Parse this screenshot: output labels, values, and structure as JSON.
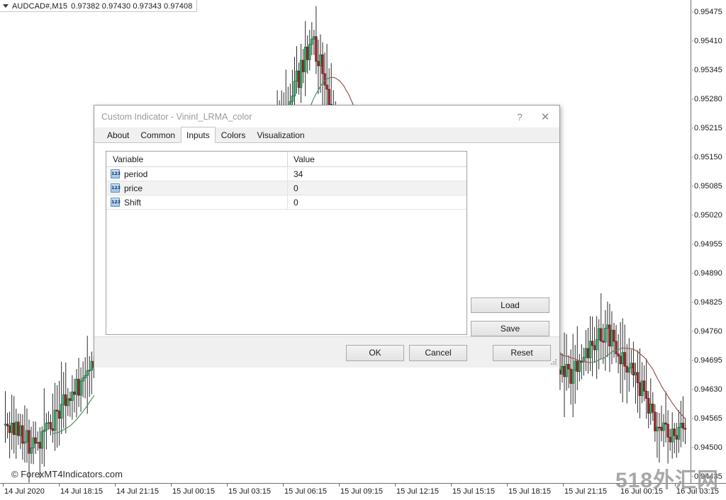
{
  "chart": {
    "symbol_label": "AUDCAD#,M15",
    "ohlc": "0.97382 0.97430 0.97343 0.97408",
    "watermark_left": "© ForexMT4Indicators.com",
    "watermark_right": "518外汇网",
    "price_ticks": [
      "0.95475",
      "0.95410",
      "0.95345",
      "0.95280",
      "0.95215",
      "0.95150",
      "0.95085",
      "0.95020",
      "0.94955",
      "0.94890",
      "0.94825",
      "0.94760",
      "0.94695",
      "0.94630",
      "0.94565",
      "0.94500",
      "0.94435"
    ],
    "time_ticks": [
      "14 Jul 2020",
      "14 Jul 18:15",
      "14 Jul 21:15",
      "15 Jul 00:15",
      "15 Jul 03:15",
      "15 Jul 06:15",
      "15 Jul 09:15",
      "15 Jul 12:15",
      "15 Jul 15:15",
      "15 Jul 18:15",
      "15 Jul 21:15",
      "16 Jul 00:15",
      "16 Jul 03:15"
    ],
    "colors": {
      "bull": "#2f9e63",
      "bear": "#9d2b2b",
      "line_up": "#4f8f63",
      "line_down": "#a05050",
      "axis": "#707070"
    }
  },
  "dialog": {
    "title": "Custom Indicator - VininI_LRMA_color",
    "help_glyph": "?",
    "close_glyph": "✕",
    "tabs": [
      {
        "label": "About",
        "active": false
      },
      {
        "label": "Common",
        "active": false
      },
      {
        "label": "Inputs",
        "active": true
      },
      {
        "label": "Colors",
        "active": false
      },
      {
        "label": "Visualization",
        "active": false
      }
    ],
    "table": {
      "columns": [
        "Variable",
        "Value"
      ],
      "rows": [
        {
          "icon": "numeric-input-icon",
          "variable": "period",
          "value": "34"
        },
        {
          "icon": "numeric-input-icon",
          "variable": "price",
          "value": "0"
        },
        {
          "icon": "numeric-input-icon",
          "variable": "Shift",
          "value": "0"
        }
      ],
      "icon_text": "123"
    },
    "side_buttons": {
      "load": "Load",
      "save": "Save"
    },
    "footer_buttons": {
      "ok": "OK",
      "cancel": "Cancel",
      "reset": "Reset"
    }
  }
}
